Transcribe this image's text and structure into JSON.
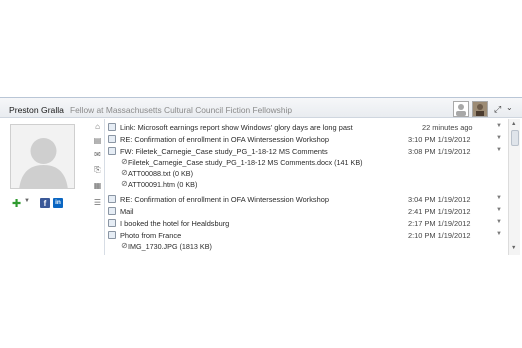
{
  "header": {
    "name": "Preston Gralla",
    "title": "Fellow at Massachusetts Cultural Council Fiction Fellowship",
    "expand_icon": "expand-icon",
    "menu_icon": "chevron-down-icon"
  },
  "social": {
    "facebook": "f",
    "linkedin": "in"
  },
  "messages": [
    {
      "subject": "Link: Microsoft earnings report show Windows' glory days are long past",
      "time": "22 minutes ago",
      "icon": "link-icon"
    },
    {
      "subject": "RE: Confirmation of enrollment in OFA Wintersession Workshop",
      "time": "3:10 PM  1/19/2012",
      "icon": "mail-icon"
    },
    {
      "subject": "FW: Filetek_Carnegie_Case study_PG_1-18-12 MS Comments",
      "time": "3:08 PM  1/19/2012",
      "icon": "mail-icon",
      "attachments": [
        "Filetek_Carnegie_Case study_PG_1-18-12 MS Comments.docx (141 KB)",
        "ATT00088.txt (0 KB)",
        "ATT00091.htm (0 KB)"
      ]
    },
    {
      "subject": "RE: Confirmation of enrollment in OFA Wintersession Workshop",
      "time": "3:04 PM  1/19/2012",
      "icon": "mail-icon"
    },
    {
      "subject": "Mail",
      "time": "2:41 PM  1/19/2012",
      "icon": "mail-icon"
    },
    {
      "subject": "I booked the hotel for Healdsburg",
      "time": "2:17 PM  1/19/2012",
      "icon": "mail-icon"
    },
    {
      "subject": "Photo from France",
      "time": "2:10 PM  1/19/2012",
      "icon": "mail-icon",
      "attachments": [
        "IMG_1730.JPG (1813 KB)"
      ]
    }
  ],
  "colors": {
    "accent": "#3b5998",
    "linkedin": "#0a66c2",
    "add": "#2f9a2f"
  }
}
